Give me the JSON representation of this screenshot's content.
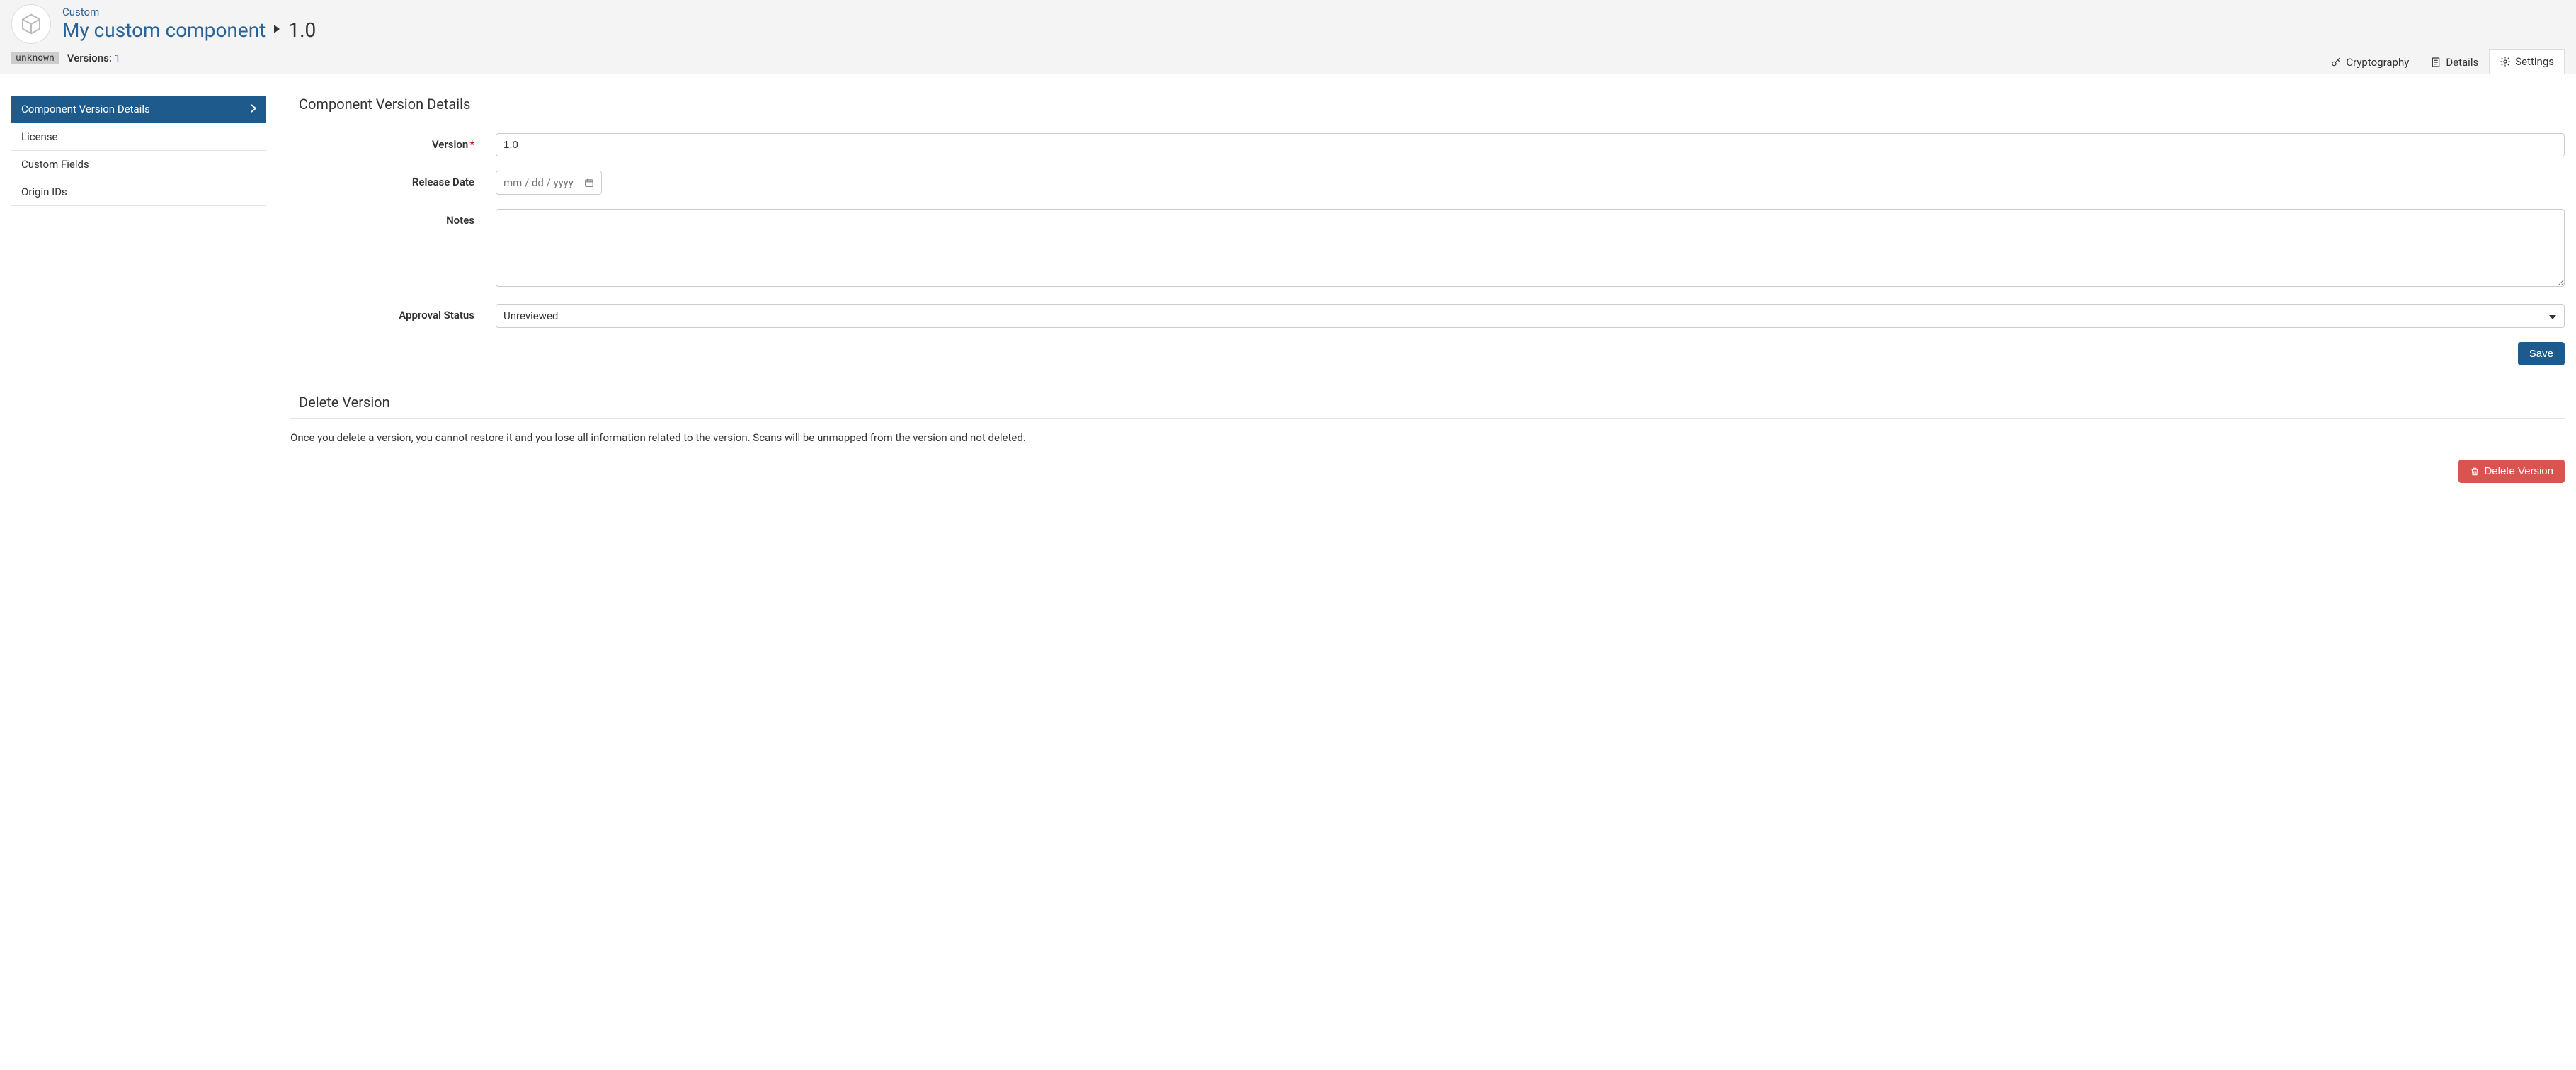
{
  "header": {
    "breadcrumb": "Custom",
    "title": "My custom component",
    "version": "1.0",
    "badge": "unknown",
    "versions_label": "Versions:",
    "versions_count": "1"
  },
  "tabs": {
    "cryptography": "Cryptography",
    "details": "Details",
    "settings": "Settings"
  },
  "sidebar": {
    "items": [
      "Component Version Details",
      "License",
      "Custom Fields",
      "Origin IDs"
    ]
  },
  "section": {
    "title": "Component Version Details",
    "labels": {
      "version": "Version",
      "release_date": "Release Date",
      "notes": "Notes",
      "approval_status": "Approval Status"
    },
    "fields": {
      "version_value": "1.0",
      "date_placeholder": "mm / dd / yyyy",
      "notes_value": "",
      "approval_value": "Unreviewed"
    },
    "save_label": "Save"
  },
  "delete_section": {
    "title": "Delete Version",
    "warning": "Once you delete a version, you cannot restore it and you lose all information related to the version. Scans will be unmapped from the version and not deleted.",
    "button": "Delete Version"
  }
}
